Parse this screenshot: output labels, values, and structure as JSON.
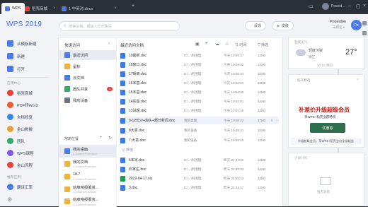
{
  "tabs": [
    {
      "label": "WPS",
      "color": "#4a7be8",
      "active": true
    },
    {
      "label": "稻壳商城",
      "color": "#e8413a",
      "active": false
    },
    {
      "label": "1 中英对.docx",
      "color": "#4a7be8",
      "active": false
    }
  ],
  "titlebar": {
    "new_tab": "+",
    "user": "Poseid..."
  },
  "sidebar": {
    "logo": "WPS 2019",
    "primary": [
      {
        "label": "从模板新建",
        "color": "#4a7be8"
      },
      {
        "label": "新建",
        "color": "#4a7be8"
      },
      {
        "label": "打开",
        "color": "#4a7be8"
      }
    ],
    "app_center_title": "应用中心",
    "apps": [
      {
        "label": "稻壳商城",
        "color": "#e8413a"
      },
      {
        "label": "PDF转Word",
        "color": "#e85d3a"
      },
      {
        "label": "文档修复",
        "color": "#3a88e8"
      },
      {
        "label": "金山數據",
        "color": "#e8a13a"
      },
      {
        "label": "团队",
        "color": "#36a86a"
      },
      {
        "label": "WPS课程",
        "color": "#7c5be8"
      },
      {
        "label": "金山流程",
        "color": "#e8413a"
      }
    ],
    "bottom_title": "推荐应用",
    "bottom_apps": [
      {
        "label": "翻译汇率",
        "color": "#4a7be8"
      }
    ]
  },
  "topbar": {
    "search_placeholder": "搜索文档，或输入打开路径",
    "feedback": "反馈",
    "skin": "皮肤",
    "username": "Poseidon",
    "user_status": "未绑定 ▾",
    "avatar_text": "Po"
  },
  "quick_access": {
    "title": "快速访问",
    "items": [
      {
        "label": "最近访问",
        "color": "#4a7be8",
        "selected": true
      },
      {
        "label": "星标",
        "color": "#f0b33a",
        "selected": false
      },
      {
        "label": "云文档",
        "color": "#4a7be8",
        "selected": false
      },
      {
        "label": "团队共享",
        "color": "#36a86a",
        "selected": false,
        "badge": "1"
      },
      {
        "label": "我的设备",
        "color": "#6b7280",
        "selected": false
      }
    ],
    "common_title": "常用位置",
    "places": [
      {
        "label": "我的桌面",
        "sub": "C:\\Users\\Poseidon\\",
        "selected": true
      },
      {
        "label": "我的文档",
        "sub": "C:\\Users\\Poseidon",
        "selected": false
      },
      {
        "label": "18.7",
        "sub": "C:\\Users\\Poseidon",
        "selected": false
      },
      {
        "label": "给康帝报服务...",
        "sub": "C:\\Users\\Poseidon",
        "selected": false
      },
      {
        "label": "给康帝报服务...",
        "sub": "C:\\Users\\Poseidon",
        "selected": false
      }
    ]
  },
  "files": {
    "title": "最近访问文档",
    "time_label": "时间",
    "filter_label": "筛选",
    "group_today": "今天",
    "group_earlier": "昨天",
    "rows": [
      {
        "name": "19最新.doc",
        "path": "E:\\...\\利围理",
        "time": "今天 10:59:47",
        "size": "12KB",
        "type": "doc"
      },
      {
        "name": "18窗口.doc",
        "path": "E:\\...\\利围理",
        "time": "今天 10:59:32",
        "size": "12KB",
        "type": "doc"
      },
      {
        "name": "17晴雨.doc",
        "path": "E:\\...\\利围理",
        "time": "今天 10:55:33",
        "size": "12KB",
        "type": "doc"
      },
      {
        "name": "16本基.doc",
        "path": "E:\\...\\利围理",
        "time": "今天 10:52:03",
        "size": "12KB",
        "type": "doc"
      },
      {
        "name": "15本基.doc",
        "path": "E:\\...\\利围理",
        "time": "今天 10:52:05",
        "size": "12KB",
        "type": "doc"
      },
      {
        "name": "14实基.doc",
        "path": "E:\\...\\利围理",
        "time": "今天 10:52:01",
        "size": "12KB",
        "type": "doc"
      },
      {
        "name": "13试题.doc",
        "path": "E:\\...\\利围理",
        "time": "今天 10:51:49",
        "size": "12KB",
        "type": "doc"
      },
      {
        "name": "9-12长沙+泡头+部分新闻.doc",
        "path": "我的桌面",
        "time": "今天 10:50:22",
        "size": "17KB",
        "type": "doc",
        "highlight": true
      },
      {
        "name": "8大意.doc",
        "path": "我的设备",
        "time": "今天 10:45:21",
        "size": "12KB",
        "type": "doc"
      },
      {
        "name": "7.大意.doc",
        "path": "我的设备",
        "time": "今天 10:45:15",
        "size": "12KB",
        "type": "doc"
      }
    ],
    "rows2": [
      {
        "name": "5本定.doc",
        "path": "E:\\...\\利围理",
        "time": "昨天 22:27:02",
        "size": "12KB",
        "type": "doc"
      },
      {
        "name": "石家庄.doc",
        "path": "E:\\...\\利围理",
        "time": "昨天 22:26:33",
        "size": "12KB",
        "type": "doc"
      },
      {
        "name": "2019-04-17.xls",
        "path": "E:\\...\\利围理",
        "time": "昨天 22:25:13",
        "size": "12KB",
        "type": "xls"
      },
      {
        "name": "3.doc",
        "path": "E:\\...\\利围理",
        "time": "昨天 22:24:47",
        "size": "12KB",
        "type": "doc"
      }
    ]
  },
  "weather": {
    "title": "轻度天气",
    "desc": "轻度污染",
    "city": "浙江 ·",
    "temp": "27°",
    "date": "10-15 周四"
  },
  "ad": {
    "title": "稻壳精选",
    "headline": "补差价升级超级会员",
    "sub": "享WPS+稻壳全部特权",
    "coupon": "优惠券",
    "footer": "升级超级会员，享WPS+稻壳会员全部权益"
  },
  "empty_panel": {
    "title": "近期计划",
    "label": "暂无消息"
  }
}
